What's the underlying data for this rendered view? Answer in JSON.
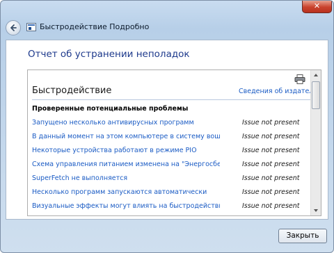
{
  "window": {
    "breadcrumb": "Быстродействие Подробно",
    "close_glyph": "✕"
  },
  "page": {
    "heading": "Отчет об устранении неполадок"
  },
  "report": {
    "section_title": "Быстродействие",
    "publisher_link": "Сведения об издателе",
    "problems_header": "Проверенные потенциальные проблемы",
    "problems": [
      {
        "name": "Запущено несколько антивирусных программ",
        "status": "Issue not present"
      },
      {
        "name": "В данный момент на этом компьютере в систему вошли ...",
        "status": "Issue not present"
      },
      {
        "name": "Некоторые устройства работают в режиме PIO",
        "status": "Issue not present"
      },
      {
        "name": "Схема управления питанием изменена на \"Энергосбереж...",
        "status": "Issue not present"
      },
      {
        "name": "SuperFetch не выполняется",
        "status": "Issue not present"
      },
      {
        "name": "Несколько программ запускаются автоматически",
        "status": "Issue not present"
      },
      {
        "name": "Визуальные эффекты могут влиять на быстродействие",
        "status": "Issue not present"
      }
    ]
  },
  "footer": {
    "close_label": "Закрыть"
  },
  "icons": {
    "back": "back-arrow-icon",
    "app": "performance-app-icon",
    "print": "printer-icon"
  },
  "colors": {
    "link": "#1a5bc4",
    "heading": "#1e3a8c",
    "close_red": "#c9422d"
  }
}
